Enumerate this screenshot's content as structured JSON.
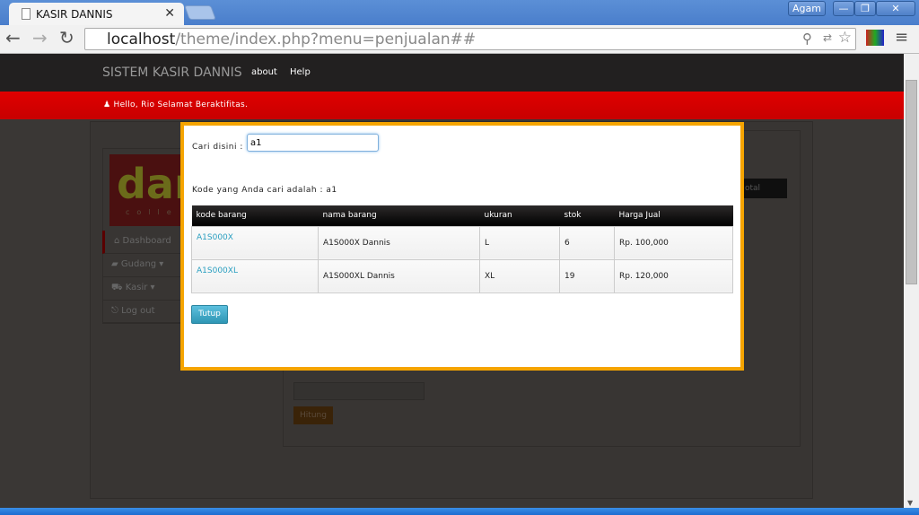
{
  "browser": {
    "tab_title": "KASIR DANNIS",
    "url_host": "localhost",
    "url_path": "/theme/index.php?menu=penjualan##",
    "user": "Agam"
  },
  "navbar": {
    "brand": "SISTEM KASIR DANNIS",
    "links": [
      "about",
      "Help"
    ]
  },
  "greeting": "Hello, Rio Selamat Beraktifitas.",
  "sidebar": {
    "logo_text": "dan",
    "logo_sub": "colle",
    "items": [
      "Dashboard",
      "Gudang",
      "Kasir",
      "Log out"
    ]
  },
  "background": {
    "total_header": "otal",
    "button": "Hitung"
  },
  "modal": {
    "search_label": "Cari disini :",
    "search_value": "a1",
    "result_text": "Kode yang Anda cari adalah : a1",
    "columns": [
      "kode barang",
      "nama barang",
      "ukuran",
      "stok",
      "Harga Jual"
    ],
    "rows": [
      [
        "A1S000X",
        "A1S000X Dannis",
        "L",
        "6",
        "Rp. 100,000"
      ],
      [
        "A1S000XL",
        "A1S000XL Dannis",
        "XL",
        "19",
        "Rp. 120,000"
      ]
    ],
    "close_label": "Tutup"
  },
  "colors": {
    "accent_border": "#f5a400",
    "link": "#2a9fc0",
    "red_bar": "#d60000"
  }
}
